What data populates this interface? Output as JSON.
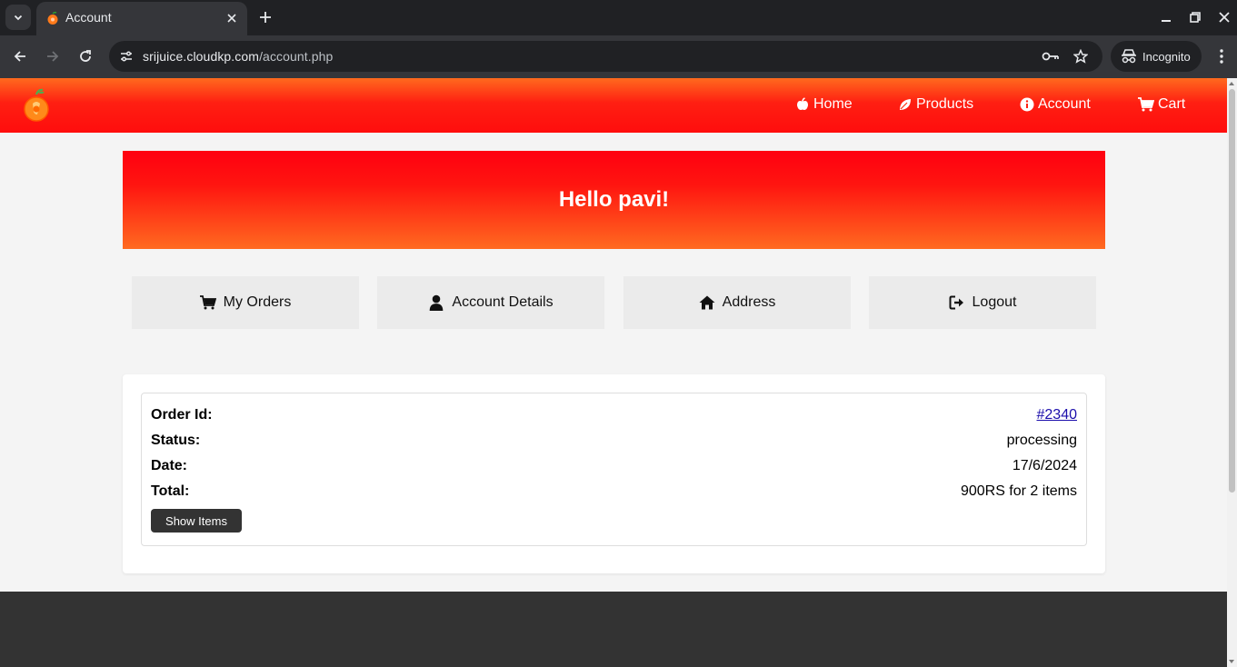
{
  "browser": {
    "tab_title": "Account",
    "url_host": "srijuice.cloudkp.com",
    "url_path": "/account.php",
    "incognito_label": "Incognito"
  },
  "header": {
    "nav": [
      {
        "label": "Home",
        "icon": "apple-icon"
      },
      {
        "label": "Products",
        "icon": "leaf-icon"
      },
      {
        "label": "Account",
        "icon": "info-icon"
      },
      {
        "label": "Cart",
        "icon": "cart-icon"
      }
    ]
  },
  "greeting": "Hello pavi!",
  "account_menu": [
    {
      "label": "My Orders",
      "icon": "cart-icon"
    },
    {
      "label": "Account Details",
      "icon": "user-icon"
    },
    {
      "label": "Address",
      "icon": "home-icon"
    },
    {
      "label": "Logout",
      "icon": "logout-icon"
    }
  ],
  "order": {
    "id_label": "Order Id:",
    "id_value": "#2340",
    "status_label": "Status:",
    "status_value": "processing",
    "date_label": "Date:",
    "date_value": "17/6/2024",
    "total_label": "Total:",
    "total_value": "900RS for 2 items",
    "show_items_label": "Show Items"
  },
  "colors": {
    "header_red": "#ff0d0d",
    "header_orange": "#ff6a1e",
    "footer": "#333333",
    "link": "#1a0dab"
  }
}
